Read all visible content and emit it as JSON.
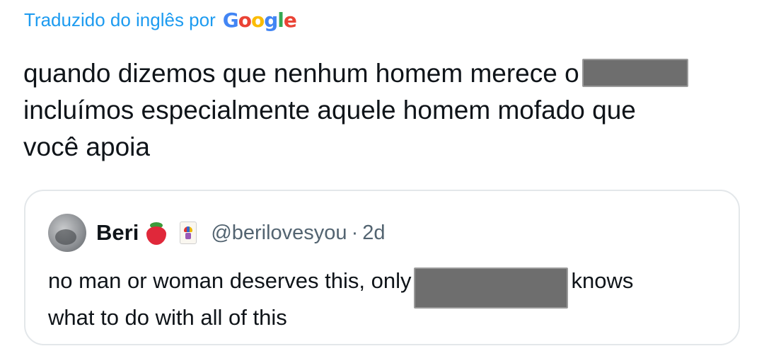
{
  "translation": {
    "label": "Traduzido do inglês por",
    "brand": {
      "g1": "G",
      "o1": "o",
      "o2": "o",
      "g2": "g",
      "l": "l",
      "e": "e"
    }
  },
  "tweet": {
    "line1": "quando dizemos que nenhum homem merece o",
    "line2": "incluímos especialmente aquele homem mofado que",
    "line3": "você apoia"
  },
  "quote": {
    "name": "Beri",
    "handle": "@berilovesyou",
    "separator": "·",
    "time": "2d",
    "text_part1": "no man or woman deserves this, only",
    "text_part2": "knows",
    "text_line2": "what to do with all of this"
  },
  "colors": {
    "link": "#1d9bf0",
    "text": "#0f1419",
    "secondary": "#536471",
    "border": "#e3e7ea",
    "redaction": "#6e6e6e"
  }
}
